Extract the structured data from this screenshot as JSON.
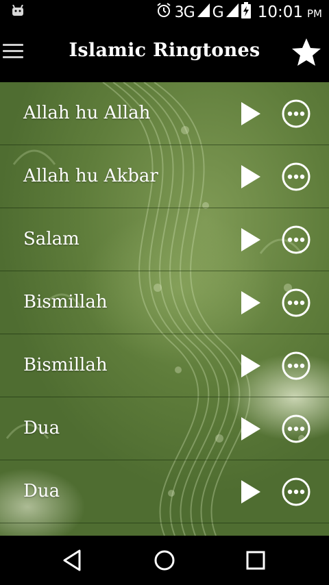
{
  "status_bar": {
    "network_3g": "3G",
    "network_g": "G",
    "time": "10:01",
    "ampm": "PM",
    "icons": [
      "android-icon",
      "alarm-icon",
      "signal-icon",
      "battery-charging-icon"
    ]
  },
  "app_bar": {
    "title": "Islamic Ringtones",
    "menu_icon": "hamburger-menu-icon",
    "favorite_icon": "star-icon"
  },
  "ringtones": [
    {
      "label": "Allah hu Allah"
    },
    {
      "label": "Allah hu Akbar"
    },
    {
      "label": "Salam"
    },
    {
      "label": "Bismillah"
    },
    {
      "label": "Bismillah"
    },
    {
      "label": "Dua"
    },
    {
      "label": "Dua"
    }
  ],
  "row_icons": {
    "play": "play-icon",
    "more": "more-options-icon"
  },
  "nav_bar": {
    "back": "back-icon",
    "home": "home-icon",
    "recents": "recents-icon"
  },
  "colors": {
    "bar_background": "#000000",
    "content_green": "#6b8a45",
    "text": "#ffffff"
  }
}
